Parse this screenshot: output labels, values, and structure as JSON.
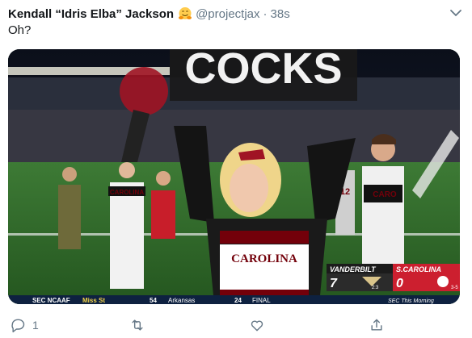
{
  "tweet": {
    "display_name": "Kendall “Idris Elba” Jackson",
    "handle": "@projectjax",
    "separator": "·",
    "time": "38s",
    "text": "Oh?"
  },
  "media": {
    "banner_text": "COCKS",
    "jersey_left": "CAROLINA",
    "jersey_center": "CAROLINA",
    "jersey_right": "CARO",
    "jersey_number": "12",
    "scorebug": {
      "team_a": "VANDERBILT",
      "team_a_score": "7",
      "team_b": "S.CAROLINA",
      "team_b_score": "0",
      "quarter": "2:3",
      "record_b": "3-5",
      "ticker": [
        {
          "label": "SEC NCAAF",
          "team": "Miss St",
          "score": "54",
          "opp": "Arkansas",
          "opp_score": "24",
          "status": "FINAL"
        }
      ],
      "ticker_right": "SEC This Morning"
    }
  },
  "actions": {
    "reply_count": "1",
    "retweet_count": "",
    "like_count": ""
  },
  "colors": {
    "name": "#14171a",
    "secondary": "#657786",
    "gamecock_garnet": "#73000a",
    "scorebug_red": "#cc1f2f",
    "field_green": "#2f6b2c"
  },
  "icons": [
    "hugging-face-emoji-icon",
    "chevron-down-icon",
    "reply-icon",
    "retweet-icon",
    "like-icon",
    "share-icon"
  ]
}
